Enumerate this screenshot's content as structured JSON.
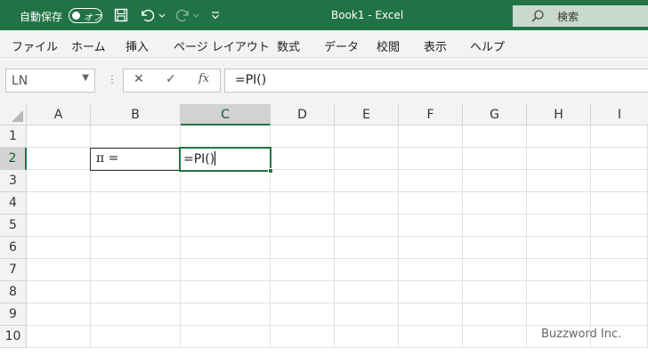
{
  "titlebar": {
    "autosave_label": "自動保存",
    "autosave_state": "オフ",
    "title": "Book1  -  Excel",
    "search_label": "検索"
  },
  "ribbon": {
    "tabs": [
      "ファイル",
      "ホーム",
      "挿入",
      "ページ レイアウト",
      "数式",
      "データ",
      "校閲",
      "表示",
      "ヘルプ"
    ]
  },
  "formula_bar": {
    "name_box": "LN",
    "cancel_icon": "✕",
    "enter_icon": "✓",
    "fx_label": "fx",
    "content": "=PI()"
  },
  "sheet": {
    "columns": [
      "A",
      "B",
      "C",
      "D",
      "E",
      "F",
      "G",
      "H",
      "I"
    ],
    "rows": [
      "1",
      "2",
      "3",
      "4",
      "5",
      "6",
      "7",
      "8",
      "9",
      "10"
    ],
    "active_column": "C",
    "active_row": "2",
    "cells": {
      "B2": "π =",
      "C2": "=PI()"
    }
  },
  "watermark": "Buzzword Inc.",
  "colors": {
    "excel_green": "#217346",
    "ribbon_bg": "#f3f3f3"
  }
}
